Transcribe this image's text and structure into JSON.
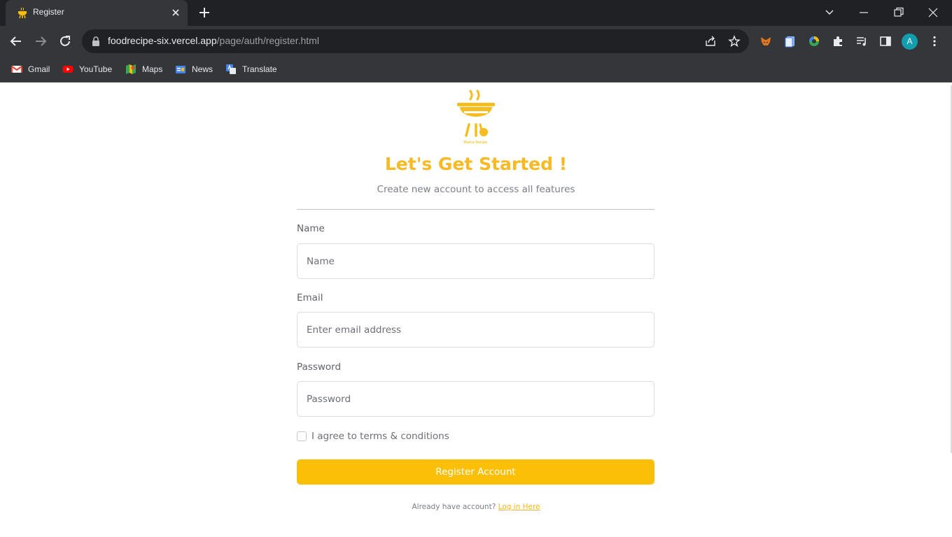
{
  "browser": {
    "tab": {
      "title": "Register"
    },
    "address": {
      "host": "foodrecipe-six.vercel.app",
      "path": "/page/auth/register.html"
    },
    "avatar_letter": "A",
    "bookmarks": [
      {
        "label": "Gmail",
        "icon": "gmail-icon"
      },
      {
        "label": "YouTube",
        "icon": "youtube-icon"
      },
      {
        "label": "Maps",
        "icon": "maps-icon"
      },
      {
        "label": "News",
        "icon": "news-icon"
      },
      {
        "label": "Translate",
        "icon": "translate-icon"
      }
    ]
  },
  "colors": {
    "accent": "#fcbf08",
    "heading": "#f7b924",
    "link": "#f5b51c",
    "chrome_dark": "#202124",
    "chrome_mid": "#35363a"
  },
  "page": {
    "logo_caption": "Mama Recipe.",
    "heading": "Let's Get Started !",
    "subheading": "Create new account to access all features",
    "form": {
      "name": {
        "label": "Name",
        "placeholder": "Name"
      },
      "email": {
        "label": "Email",
        "placeholder": "Enter email address"
      },
      "password": {
        "label": "Password",
        "placeholder": "Password"
      },
      "terms_label": "I agree to terms & conditions",
      "submit_label": "Register Account"
    },
    "footer": {
      "text": "Already have account?",
      "link": "Log in Here"
    }
  }
}
